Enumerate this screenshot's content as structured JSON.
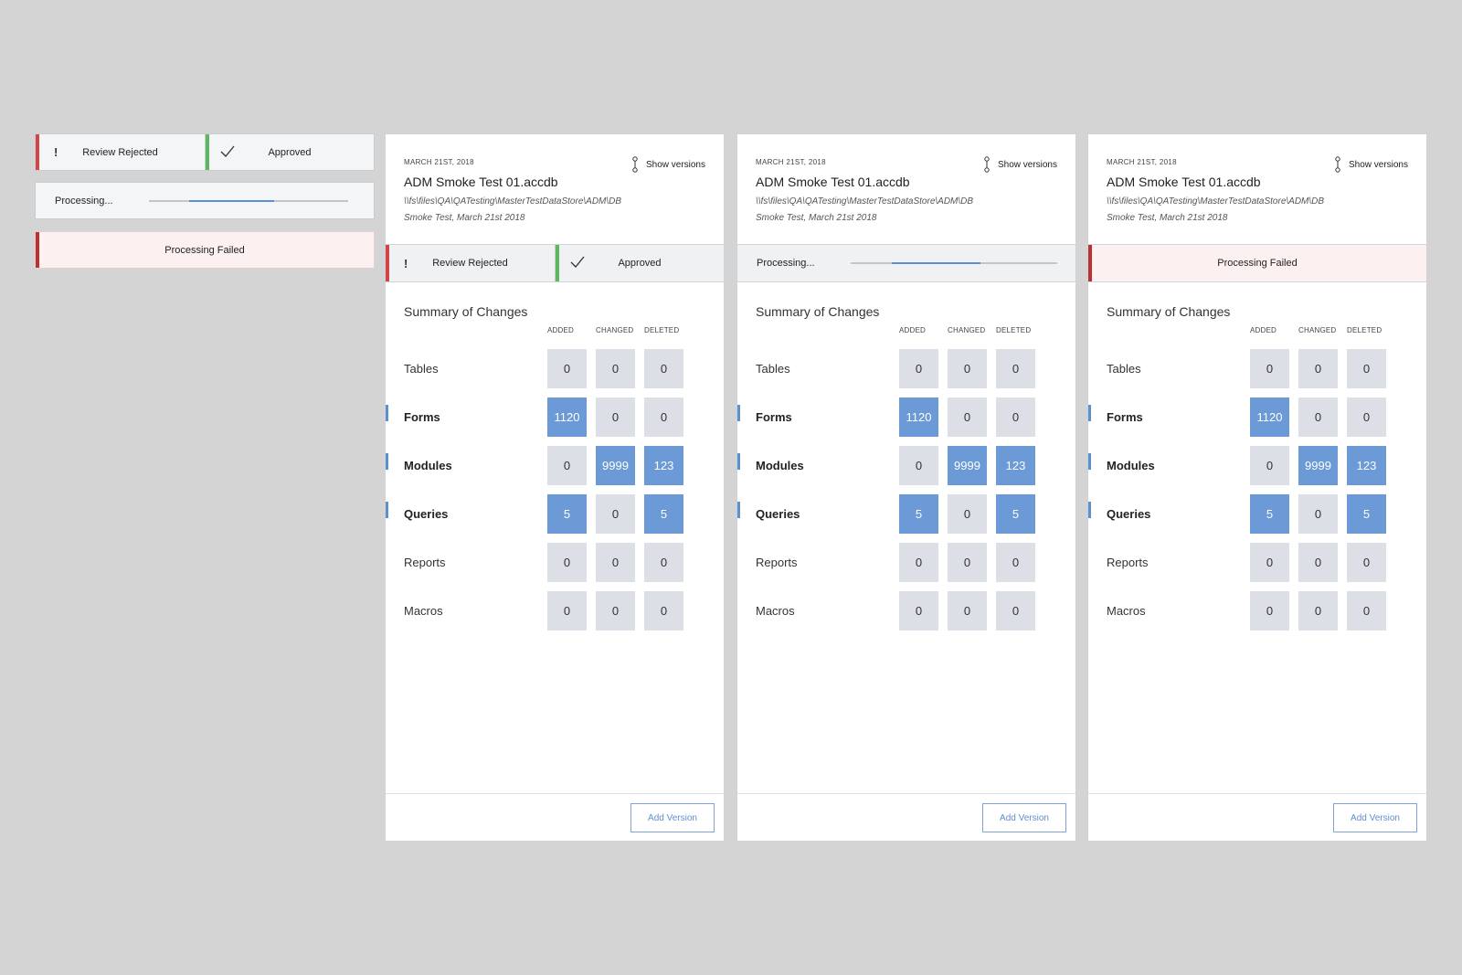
{
  "components": {
    "review": {
      "rejected_label": "Review Rejected",
      "rejected_glyph": "!",
      "approved_label": "Approved"
    },
    "processing": {
      "label": "Processing...",
      "progress_start": 0.2,
      "progress_end": 0.63
    },
    "failed": {
      "label": "Processing Failed"
    }
  },
  "colors": {
    "accent": "#5a8fd0",
    "highlight_cell": "#6b9ad6",
    "neutral_cell": "#dcdfe5",
    "rejected": "#d64545",
    "approved": "#5cb85c",
    "failed": "#b83232",
    "failed_bg": "#fdf0f0"
  },
  "card": {
    "date": "MARCH 21ST, 2018",
    "filename": "ADM Smoke Test 01.accdb",
    "path": "\\\\fs\\files\\QA\\QATesting\\MasterTestDataStore\\ADM\\DB Smoke Test, March 21st 2018",
    "show_versions": "Show versions",
    "summary_title": "Summary of Changes",
    "columns": [
      "ADDED",
      "CHANGED",
      "DELETED"
    ],
    "rows": [
      {
        "label": "Tables",
        "changed": false,
        "values": [
          "0",
          "0",
          "0"
        ]
      },
      {
        "label": "Forms",
        "changed": true,
        "values": [
          "1120",
          "0",
          "0"
        ]
      },
      {
        "label": "Modules",
        "changed": true,
        "values": [
          "0",
          "9999",
          "123"
        ]
      },
      {
        "label": "Queries",
        "changed": true,
        "values": [
          "5",
          "0",
          "5"
        ]
      },
      {
        "label": "Reports",
        "changed": false,
        "values": [
          "0",
          "0",
          "0"
        ]
      },
      {
        "label": "Macros",
        "changed": false,
        "values": [
          "0",
          "0",
          "0"
        ]
      }
    ],
    "add_version": "Add Version"
  },
  "cards": [
    {
      "status": "review"
    },
    {
      "status": "processing",
      "progress_start": 0.2,
      "progress_end": 0.63
    },
    {
      "status": "failed"
    }
  ]
}
